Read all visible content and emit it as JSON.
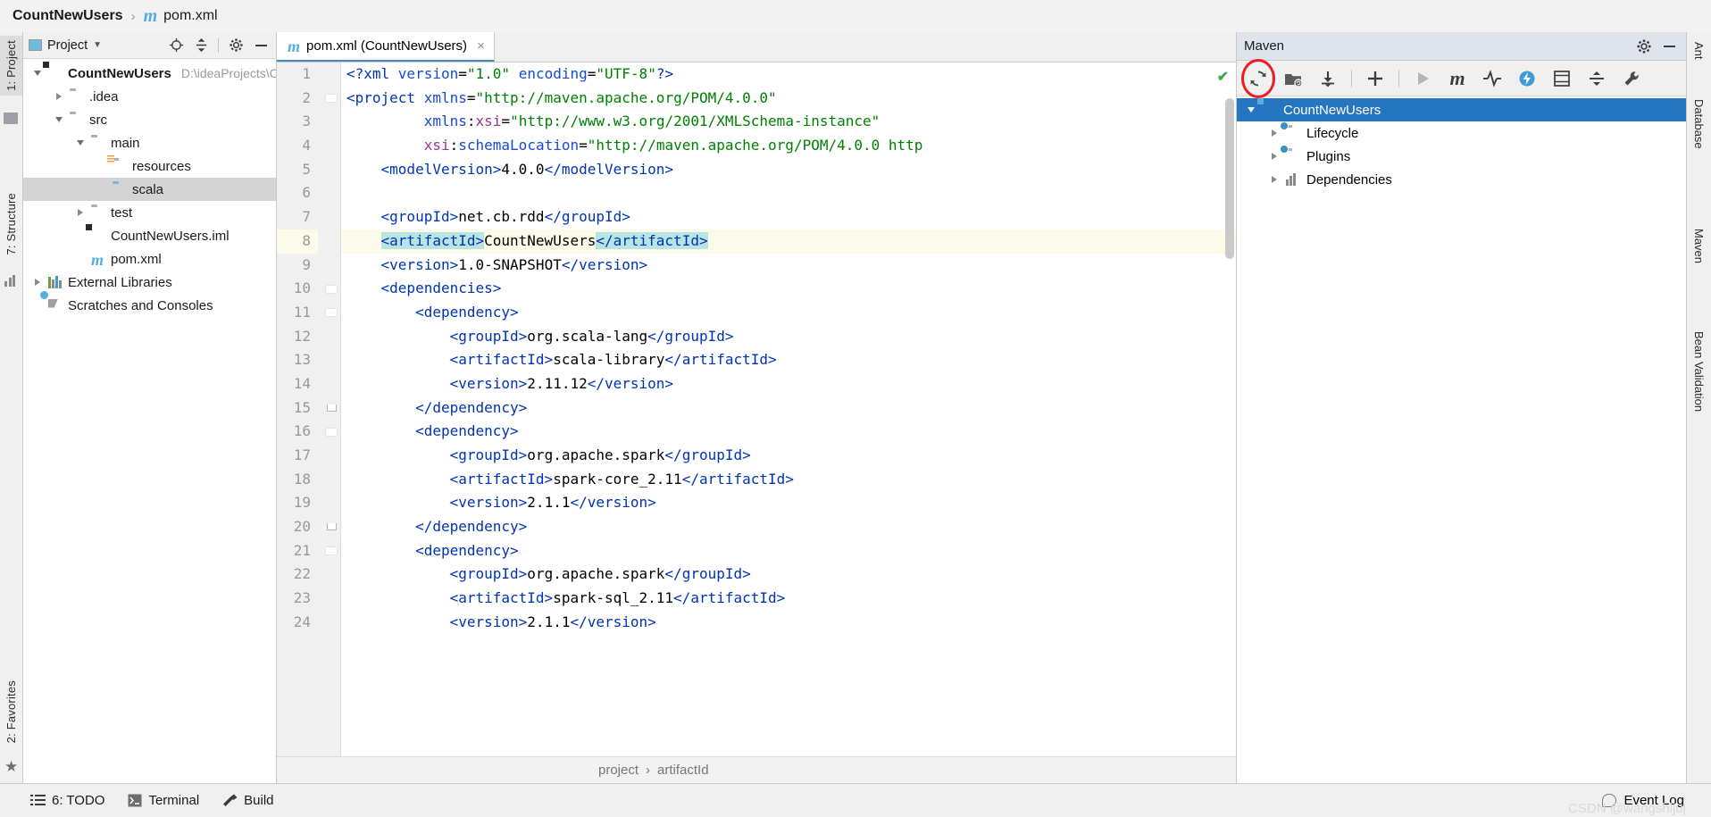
{
  "titlebar": {
    "project": "CountNewUsers",
    "separator": "›",
    "file": "pom.xml",
    "file_icon": "maven-m-icon"
  },
  "project_panel": {
    "header_title": "Project",
    "buttons": [
      "locate-icon",
      "collapse-all-icon",
      "gear-icon",
      "hide-icon"
    ],
    "tree": [
      {
        "label": "CountNewUsers",
        "path": "D:\\ideaProjects\\C",
        "depth": 0,
        "twisty": "down",
        "icon": "module-icon",
        "bold": true,
        "selected": false
      },
      {
        "label": ".idea",
        "path": "",
        "depth": 1,
        "twisty": "right",
        "icon": "folder-icon",
        "bold": false,
        "selected": false
      },
      {
        "label": "src",
        "path": "",
        "depth": 1,
        "twisty": "down",
        "icon": "folder-icon",
        "bold": false,
        "selected": false
      },
      {
        "label": "main",
        "path": "",
        "depth": 2,
        "twisty": "down",
        "icon": "folder-icon",
        "bold": false,
        "selected": false
      },
      {
        "label": "resources",
        "path": "",
        "depth": 3,
        "twisty": "none",
        "icon": "folder-resources-icon",
        "bold": false,
        "selected": false
      },
      {
        "label": "scala",
        "path": "",
        "depth": 3,
        "twisty": "none",
        "icon": "folder-source-icon",
        "bold": false,
        "selected": true
      },
      {
        "label": "test",
        "path": "",
        "depth": 2,
        "twisty": "right",
        "icon": "folder-icon",
        "bold": false,
        "selected": false
      },
      {
        "label": "CountNewUsers.iml",
        "path": "",
        "depth": 2,
        "twisty": "none",
        "icon": "iml-file-icon",
        "bold": false,
        "selected": false
      },
      {
        "label": "pom.xml",
        "path": "",
        "depth": 2,
        "twisty": "none",
        "icon": "maven-m-icon",
        "bold": false,
        "selected": false
      },
      {
        "label": "External Libraries",
        "path": "",
        "depth": 0,
        "twisty": "right",
        "icon": "libraries-icon",
        "bold": false,
        "selected": false
      },
      {
        "label": "Scratches and Consoles",
        "path": "",
        "depth": 0,
        "twisty": "none",
        "icon": "scratches-icon",
        "bold": false,
        "selected": false
      }
    ]
  },
  "left_strip": {
    "tabs": [
      "1: Project",
      "7: Structure",
      "2: Favorites"
    ],
    "icons": [
      "project-icon",
      "structure-icon",
      "favorites-star-icon"
    ]
  },
  "right_strip": {
    "tabs": [
      "Ant",
      "Database",
      "Maven",
      "Bean Validation"
    ]
  },
  "editor": {
    "tab_label": "pom.xml (CountNewUsers)",
    "tab_icon": "maven-m-icon",
    "tab_close": "×",
    "inspection_status": "ok-check-icon",
    "breadcrumb": [
      "project",
      "artifactId"
    ],
    "breadcrumb_sep": "›",
    "lines": [
      {
        "n": 1,
        "fold": "none",
        "hl": false,
        "spans": [
          {
            "t": "<?xml ",
            "c": "t-pi"
          },
          {
            "t": "version",
            "c": "t-attr"
          },
          {
            "t": "=",
            "c": "t-txt"
          },
          {
            "t": "\"1.0\"",
            "c": "t-str"
          },
          {
            "t": " ",
            "c": "t-txt"
          },
          {
            "t": "encoding",
            "c": "t-attr"
          },
          {
            "t": "=",
            "c": "t-txt"
          },
          {
            "t": "\"UTF-8\"",
            "c": "t-str"
          },
          {
            "t": "?>",
            "c": "t-pi"
          }
        ]
      },
      {
        "n": 2,
        "fold": "tri",
        "hl": false,
        "spans": [
          {
            "t": "<project",
            "c": "t-tag"
          },
          {
            "t": " ",
            "c": "t-txt"
          },
          {
            "t": "xmlns",
            "c": "t-attr"
          },
          {
            "t": "=",
            "c": "t-txt"
          },
          {
            "t": "\"http://maven.apache.org/POM/4.0.0\"",
            "c": "t-str"
          }
        ]
      },
      {
        "n": 3,
        "fold": "none",
        "hl": false,
        "spans": [
          {
            "t": "         ",
            "c": "t-txt"
          },
          {
            "t": "xmlns",
            "c": "t-attr"
          },
          {
            "t": ":",
            "c": "t-txt"
          },
          {
            "t": "xsi",
            "c": "t-ns"
          },
          {
            "t": "=",
            "c": "t-txt"
          },
          {
            "t": "\"http://www.w3.org/2001/XMLSchema-instance\"",
            "c": "t-str"
          }
        ]
      },
      {
        "n": 4,
        "fold": "none",
        "hl": false,
        "spans": [
          {
            "t": "         ",
            "c": "t-txt"
          },
          {
            "t": "xsi",
            "c": "t-ns"
          },
          {
            "t": ":",
            "c": "t-txt"
          },
          {
            "t": "schemaLocation",
            "c": "t-attr"
          },
          {
            "t": "=",
            "c": "t-txt"
          },
          {
            "t": "\"http://maven.apache.org/POM/4.0.0 http",
            "c": "t-str"
          }
        ]
      },
      {
        "n": 5,
        "fold": "none",
        "hl": false,
        "spans": [
          {
            "t": "    ",
            "c": "t-txt"
          },
          {
            "t": "<modelVersion>",
            "c": "t-tag"
          },
          {
            "t": "4.0.0",
            "c": "t-txt"
          },
          {
            "t": "</modelVersion>",
            "c": "t-tag"
          }
        ]
      },
      {
        "n": 6,
        "fold": "none",
        "hl": false,
        "spans": []
      },
      {
        "n": 7,
        "fold": "none",
        "hl": false,
        "spans": [
          {
            "t": "    ",
            "c": "t-txt"
          },
          {
            "t": "<groupId>",
            "c": "t-tag"
          },
          {
            "t": "net.cb.rdd",
            "c": "t-txt"
          },
          {
            "t": "</groupId>",
            "c": "t-tag"
          }
        ]
      },
      {
        "n": 8,
        "fold": "none",
        "hl": true,
        "spans": [
          {
            "t": "    ",
            "c": "t-txt"
          },
          {
            "t": "<artifactId>",
            "c": "t-tag sel-tag"
          },
          {
            "t": "CountNewUsers",
            "c": "t-txt"
          },
          {
            "t": "</artifactId>",
            "c": "t-tag sel-tag"
          }
        ]
      },
      {
        "n": 9,
        "fold": "none",
        "hl": false,
        "spans": [
          {
            "t": "    ",
            "c": "t-txt"
          },
          {
            "t": "<version>",
            "c": "t-tag"
          },
          {
            "t": "1.0-SNAPSHOT",
            "c": "t-txt"
          },
          {
            "t": "</version>",
            "c": "t-tag"
          }
        ]
      },
      {
        "n": 10,
        "fold": "tri",
        "hl": false,
        "spans": [
          {
            "t": "    ",
            "c": "t-txt"
          },
          {
            "t": "<dependencies>",
            "c": "t-tag"
          }
        ]
      },
      {
        "n": 11,
        "fold": "tri",
        "hl": false,
        "spans": [
          {
            "t": "        ",
            "c": "t-txt"
          },
          {
            "t": "<dependency>",
            "c": "t-tag"
          }
        ]
      },
      {
        "n": 12,
        "fold": "none",
        "hl": false,
        "spans": [
          {
            "t": "            ",
            "c": "t-txt"
          },
          {
            "t": "<groupId>",
            "c": "t-tag"
          },
          {
            "t": "org.scala-lang",
            "c": "t-txt"
          },
          {
            "t": "</groupId>",
            "c": "t-tag"
          }
        ]
      },
      {
        "n": 13,
        "fold": "none",
        "hl": false,
        "spans": [
          {
            "t": "            ",
            "c": "t-txt"
          },
          {
            "t": "<artifactId>",
            "c": "t-tag"
          },
          {
            "t": "scala-library",
            "c": "t-txt"
          },
          {
            "t": "</artifactId>",
            "c": "t-tag"
          }
        ]
      },
      {
        "n": 14,
        "fold": "none",
        "hl": false,
        "spans": [
          {
            "t": "            ",
            "c": "t-txt"
          },
          {
            "t": "<version>",
            "c": "t-tag"
          },
          {
            "t": "2.11.12",
            "c": "t-txt"
          },
          {
            "t": "</version>",
            "c": "t-tag"
          }
        ]
      },
      {
        "n": 15,
        "fold": "end",
        "hl": false,
        "spans": [
          {
            "t": "        ",
            "c": "t-txt"
          },
          {
            "t": "</dependency>",
            "c": "t-tag"
          }
        ]
      },
      {
        "n": 16,
        "fold": "tri",
        "hl": false,
        "spans": [
          {
            "t": "        ",
            "c": "t-txt"
          },
          {
            "t": "<dependency>",
            "c": "t-tag"
          }
        ]
      },
      {
        "n": 17,
        "fold": "none",
        "hl": false,
        "spans": [
          {
            "t": "            ",
            "c": "t-txt"
          },
          {
            "t": "<groupId>",
            "c": "t-tag"
          },
          {
            "t": "org.apache.spark",
            "c": "t-txt"
          },
          {
            "t": "</groupId>",
            "c": "t-tag"
          }
        ]
      },
      {
        "n": 18,
        "fold": "none",
        "hl": false,
        "spans": [
          {
            "t": "            ",
            "c": "t-txt"
          },
          {
            "t": "<artifactId>",
            "c": "t-tag"
          },
          {
            "t": "spark-core_2.11",
            "c": "t-txt"
          },
          {
            "t": "</artifactId>",
            "c": "t-tag"
          }
        ]
      },
      {
        "n": 19,
        "fold": "none",
        "hl": false,
        "spans": [
          {
            "t": "            ",
            "c": "t-txt"
          },
          {
            "t": "<version>",
            "c": "t-tag"
          },
          {
            "t": "2.1.1",
            "c": "t-txt"
          },
          {
            "t": "</version>",
            "c": "t-tag"
          }
        ]
      },
      {
        "n": 20,
        "fold": "end",
        "hl": false,
        "spans": [
          {
            "t": "        ",
            "c": "t-txt"
          },
          {
            "t": "</dependency>",
            "c": "t-tag"
          }
        ]
      },
      {
        "n": 21,
        "fold": "tri",
        "hl": false,
        "spans": [
          {
            "t": "        ",
            "c": "t-txt"
          },
          {
            "t": "<dependency>",
            "c": "t-tag"
          }
        ]
      },
      {
        "n": 22,
        "fold": "none",
        "hl": false,
        "spans": [
          {
            "t": "            ",
            "c": "t-txt"
          },
          {
            "t": "<groupId>",
            "c": "t-tag"
          },
          {
            "t": "org.apache.spark",
            "c": "t-txt"
          },
          {
            "t": "</groupId>",
            "c": "t-tag"
          }
        ]
      },
      {
        "n": 23,
        "fold": "none",
        "hl": false,
        "spans": [
          {
            "t": "            ",
            "c": "t-txt"
          },
          {
            "t": "<artifactId>",
            "c": "t-tag"
          },
          {
            "t": "spark-sql_2.11",
            "c": "t-txt"
          },
          {
            "t": "</artifactId>",
            "c": "t-tag"
          }
        ]
      },
      {
        "n": 24,
        "fold": "none",
        "hl": false,
        "spans": [
          {
            "t": "            ",
            "c": "t-txt"
          },
          {
            "t": "<version>",
            "c": "t-tag"
          },
          {
            "t": "2.1.1",
            "c": "t-txt"
          },
          {
            "t": "</version>",
            "c": "t-tag"
          }
        ]
      }
    ]
  },
  "maven": {
    "title": "Maven",
    "header_buttons": [
      "gear-icon",
      "hide-icon"
    ],
    "toolbar": [
      {
        "name": "reload-all-maven-projects-icon",
        "highlighted": true
      },
      {
        "name": "add-maven-project-icon",
        "highlighted": false
      },
      {
        "name": "download-sources-icon",
        "highlighted": false
      },
      {
        "name": "divider",
        "highlighted": false
      },
      {
        "name": "add-plus-icon",
        "highlighted": false
      },
      {
        "name": "divider",
        "highlighted": false
      },
      {
        "name": "run-play-icon",
        "highlighted": false
      },
      {
        "name": "execute-maven-goal-icon",
        "highlighted": false
      },
      {
        "name": "toggle-skip-tests-icon",
        "highlighted": false
      },
      {
        "name": "toggle-offline-mode-icon",
        "highlighted": false
      },
      {
        "name": "expand-all-icon",
        "highlighted": false
      },
      {
        "name": "collapse-all-icon",
        "highlighted": false
      },
      {
        "name": "maven-settings-wrench-icon",
        "highlighted": false
      }
    ],
    "highlight_color": "#ee1c25",
    "tree": [
      {
        "label": "CountNewUsers",
        "depth": 0,
        "twisty": "down",
        "icon": "maven-module-icon",
        "selected": true
      },
      {
        "label": "Lifecycle",
        "depth": 1,
        "twisty": "right",
        "icon": "lifecycle-folder-icon",
        "selected": false
      },
      {
        "label": "Plugins",
        "depth": 1,
        "twisty": "right",
        "icon": "plugins-folder-icon",
        "selected": false
      },
      {
        "label": "Dependencies",
        "depth": 1,
        "twisty": "right",
        "icon": "dependencies-icon",
        "selected": false
      }
    ]
  },
  "statusbar": {
    "items": [
      {
        "label": "6: TODO",
        "underline_char": "6",
        "icon": "todo-list-icon"
      },
      {
        "label": "Terminal",
        "underline_char": "",
        "icon": "terminal-icon"
      },
      {
        "label": "Build",
        "underline_char": "",
        "icon": "build-hammer-icon"
      }
    ],
    "event_log": "Event Log",
    "event_log_icon": "event-log-bubble-icon",
    "watermark": "CSDN @wangshijuj"
  }
}
